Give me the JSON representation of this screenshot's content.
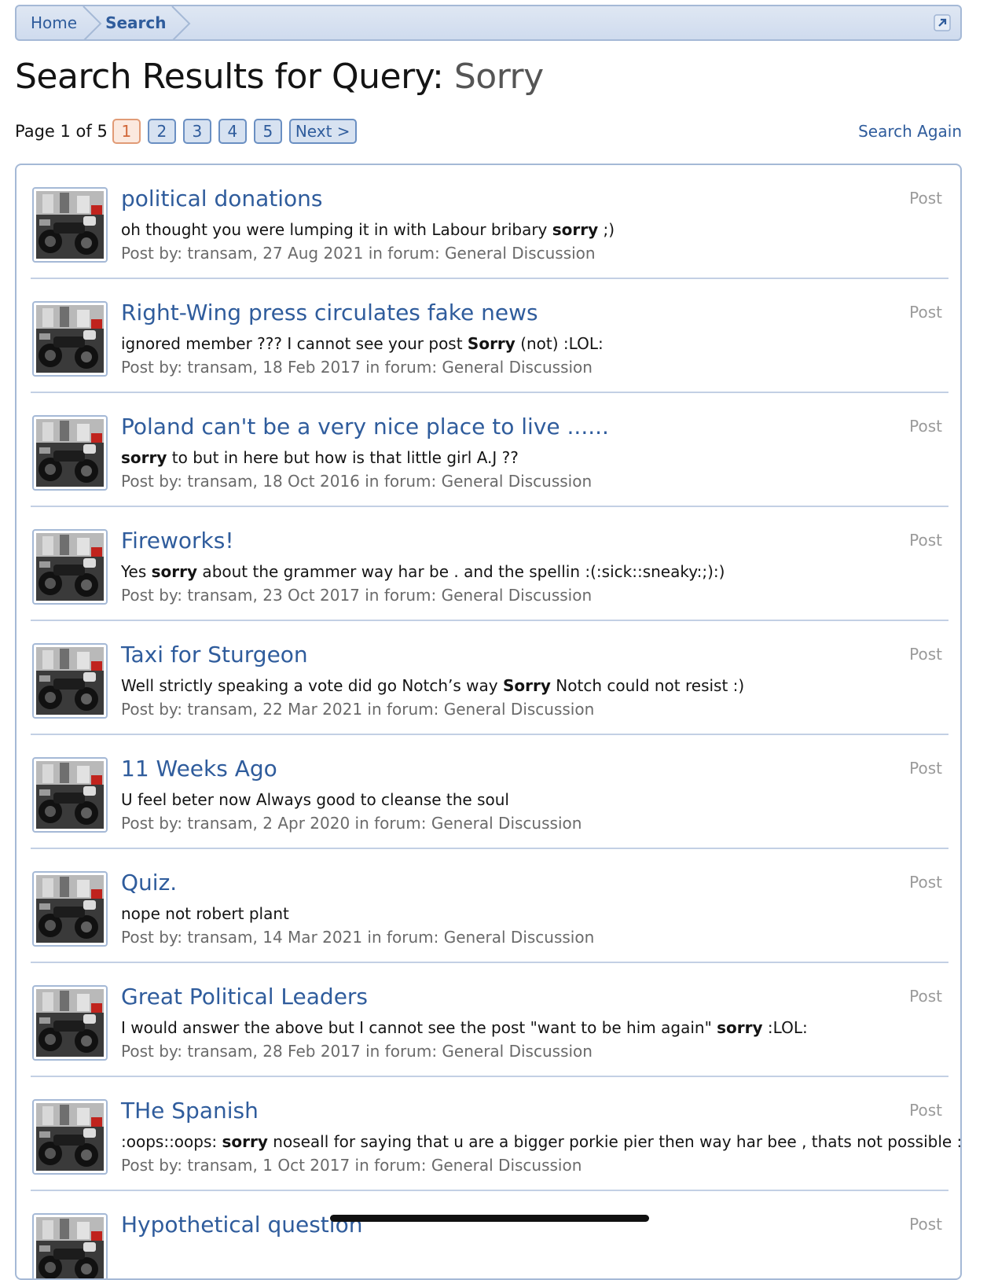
{
  "breadcrumb": {
    "items": [
      "Home",
      "Search"
    ]
  },
  "header": {
    "title_prefix": "Search Results for Query:",
    "query": "Sorry"
  },
  "pagination": {
    "label": "Page 1 of 5",
    "pages": [
      "1",
      "2",
      "3",
      "4",
      "5"
    ],
    "current": "1",
    "next_label": "Next >"
  },
  "search_again_label": "Search Again",
  "results": [
    {
      "title": "political donations",
      "snippet_before": "oh thought you were lumping it in with Labour bribary ",
      "snippet_match": "sorry",
      "snippet_after": " ;)",
      "meta": "Post by: transam, 27 Aug 2021 in forum: General Discussion",
      "type": "Post"
    },
    {
      "title": "Right-Wing press circulates fake news",
      "snippet_before": "ignored member ??? I cannot see your post ",
      "snippet_match": "Sorry",
      "snippet_after": " (not) :LOL:",
      "meta": "Post by: transam, 18 Feb 2017 in forum: General Discussion",
      "type": "Post"
    },
    {
      "title": "Poland can't be a very nice place to live ......",
      "snippet_before": "",
      "snippet_match": "sorry",
      "snippet_after": " to but in here but how is that little girl A.J ??",
      "meta": "Post by: transam, 18 Oct 2016 in forum: General Discussion",
      "type": "Post"
    },
    {
      "title": "Fireworks!",
      "snippet_before": "Yes ",
      "snippet_match": "sorry",
      "snippet_after": " about the grammer way har be . and the spellin :(:sick::sneaky:;):)",
      "meta": "Post by: transam, 23 Oct 2017 in forum: General Discussion",
      "type": "Post"
    },
    {
      "title": "Taxi for Sturgeon",
      "snippet_before": "Well strictly speaking a vote did go Notch’s way ",
      "snippet_match": "Sorry",
      "snippet_after": " Notch could not resist :)",
      "meta": "Post by: transam, 22 Mar 2021 in forum: General Discussion",
      "type": "Post"
    },
    {
      "title": "11 Weeks Ago",
      "snippet_before": "U feel beter now Always good to cleanse the soul",
      "snippet_match": "",
      "snippet_after": "",
      "meta": "Post by: transam, 2 Apr 2020 in forum: General Discussion",
      "type": "Post"
    },
    {
      "title": "Quiz.",
      "snippet_before": "nope not robert plant",
      "snippet_match": "",
      "snippet_after": "",
      "meta": "Post by: transam, 14 Mar 2021 in forum: General Discussion",
      "type": "Post"
    },
    {
      "title": "Great Political Leaders",
      "snippet_before": "I would answer the above but I cannot see the post \"want to be him again\" ",
      "snippet_match": "sorry",
      "snippet_after": " :LOL:",
      "meta": "Post by: transam, 28 Feb 2017 in forum: General Discussion",
      "type": "Post"
    },
    {
      "title": "THe Spanish",
      "snippet_before": ":oops::oops: ",
      "snippet_match": "sorry",
      "snippet_after": " noseall for saying that u are a bigger porkie pier then way har bee , thats not possible :LOL:",
      "meta": "Post by: transam, 1 Oct 2017 in forum: General Discussion",
      "type": "Post"
    },
    {
      "title": "Hypothetical question",
      "snippet_before": "",
      "snippet_match": "",
      "snippet_after": "",
      "meta": "",
      "type": "Post"
    }
  ]
}
